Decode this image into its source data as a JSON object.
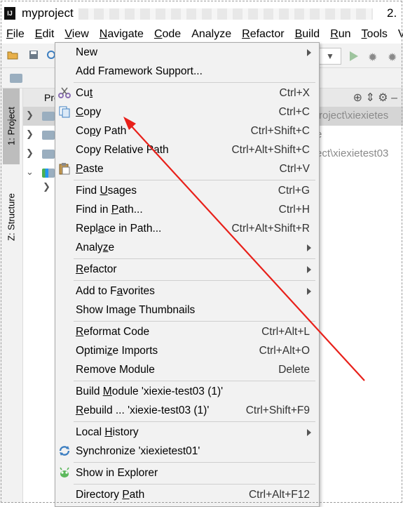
{
  "window": {
    "title": "myproject",
    "version_fragment": "2."
  },
  "menubar": [
    {
      "label": "File",
      "mnemonic_index": 0
    },
    {
      "label": "Edit",
      "mnemonic_index": 0
    },
    {
      "label": "View",
      "mnemonic_index": 0
    },
    {
      "label": "Navigate",
      "mnemonic_index": 0
    },
    {
      "label": "Code",
      "mnemonic_index": 0
    },
    {
      "label": "Analyze",
      "mnemonic_index": -1
    },
    {
      "label": "Refactor",
      "mnemonic_index": 0
    },
    {
      "label": "Build",
      "mnemonic_index": 0
    },
    {
      "label": "Run",
      "mnemonic_index": 0
    },
    {
      "label": "Tools",
      "mnemonic_index": 0
    },
    {
      "label": "V",
      "mnemonic_index": -1
    }
  ],
  "tool_windows": {
    "project_tab": "1: Project",
    "structure_tab": "Z: Structure"
  },
  "project_panel": {
    "title_fragment": "Pro",
    "rows": [
      {
        "text": "roject\\xiexietes"
      },
      {
        "text": "e"
      },
      {
        "text": "ect\\xiexietest03"
      }
    ]
  },
  "context_menu": {
    "items": [
      {
        "id": "new",
        "label": "New",
        "submenu": true,
        "icon": null
      },
      {
        "id": "add-framework",
        "label": "Add Framework Support...",
        "icon": null
      },
      {
        "sep": true
      },
      {
        "id": "cut",
        "label": "Cut",
        "mnemonic_char": "t",
        "shortcut": "Ctrl+X",
        "icon": "scissors-icon"
      },
      {
        "id": "copy",
        "label": "Copy",
        "mnemonic_char": "C",
        "shortcut": "Ctrl+C",
        "icon": "copy-icon"
      },
      {
        "id": "copy-path",
        "label": "Copy Path",
        "mnemonic_char": "p",
        "shortcut": "Ctrl+Shift+C",
        "icon": null
      },
      {
        "id": "copy-relative-path",
        "label": "Copy Relative Path",
        "shortcut": "Ctrl+Alt+Shift+C",
        "icon": null
      },
      {
        "id": "paste",
        "label": "Paste",
        "mnemonic_char": "P",
        "shortcut": "Ctrl+V",
        "icon": "paste-icon"
      },
      {
        "sep": true
      },
      {
        "id": "find-usages",
        "label": "Find Usages",
        "mnemonic_char": "U",
        "shortcut": "Ctrl+G",
        "icon": null
      },
      {
        "id": "find-in-path",
        "label": "Find in Path...",
        "mnemonic_char": "P",
        "shortcut": "Ctrl+H",
        "icon": null
      },
      {
        "id": "replace-in-path",
        "label": "Replace in Path...",
        "mnemonic_char": "a",
        "shortcut": "Ctrl+Alt+Shift+R",
        "icon": null
      },
      {
        "id": "analyze",
        "label": "Analyze",
        "mnemonic_char": "z",
        "submenu": true,
        "icon": null
      },
      {
        "sep": true
      },
      {
        "id": "refactor",
        "label": "Refactor",
        "mnemonic_char": "R",
        "submenu": true,
        "icon": null
      },
      {
        "sep": true
      },
      {
        "id": "add-to-favorites",
        "label": "Add to Favorites",
        "mnemonic_char": "a",
        "submenu": true,
        "icon": null
      },
      {
        "id": "show-image-thumbnails",
        "label": "Show Image Thumbnails",
        "icon": null
      },
      {
        "sep": true
      },
      {
        "id": "reformat-code",
        "label": "Reformat Code",
        "mnemonic_char": "R",
        "shortcut": "Ctrl+Alt+L",
        "icon": null
      },
      {
        "id": "optimize-imports",
        "label": "Optimize Imports",
        "mnemonic_char": "z",
        "shortcut": "Ctrl+Alt+O",
        "icon": null
      },
      {
        "id": "remove-module",
        "label": "Remove Module",
        "shortcut": "Delete",
        "icon": null
      },
      {
        "sep": true
      },
      {
        "id": "build-module",
        "label": "Build Module 'xiexie-test03 (1)'",
        "mnemonic_char": "M",
        "icon": null
      },
      {
        "id": "rebuild",
        "label": "Rebuild ... 'xiexie-test03 (1)'",
        "mnemonic_char": "R",
        "shortcut": "Ctrl+Shift+F9",
        "icon": null
      },
      {
        "sep": true
      },
      {
        "id": "local-history",
        "label": "Local History",
        "mnemonic_char": "H",
        "submenu": true,
        "icon": null
      },
      {
        "id": "synchronize",
        "label": "Synchronize 'xiexietest01'",
        "icon": "sync-icon"
      },
      {
        "sep": true
      },
      {
        "id": "show-in-explorer",
        "label": "Show in Explorer",
        "icon": "explorer-icon"
      },
      {
        "sep": true
      },
      {
        "id": "directory-path",
        "label": "Directory Path",
        "mnemonic_char": "P",
        "shortcut": "Ctrl+Alt+F12",
        "icon": null
      }
    ]
  },
  "colors": {
    "annotation_arrow": "#e8201a",
    "menu_bg": "#f2f2f2",
    "selection_gray": "#d5d5d5"
  }
}
